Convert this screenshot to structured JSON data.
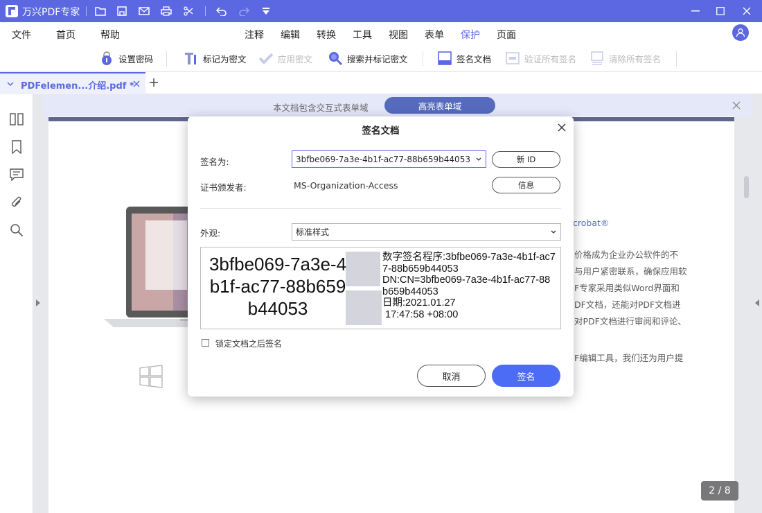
{
  "app": {
    "title": "万兴PDF专家",
    "brand_color": "#5b68e2"
  },
  "menu": {
    "items": [
      "文件",
      "首页",
      "帮助",
      "注释",
      "编辑",
      "转换",
      "工具",
      "视图",
      "表单",
      "保护",
      "页面"
    ],
    "active": "保护"
  },
  "toolbar": {
    "set_password": "设置密码",
    "mark_redaction": "标记为密文",
    "apply_redaction": "应用密文",
    "search_redact": "搜索并标记密文",
    "sign_document": "签名文档",
    "verify_all": "验证所有签名",
    "clear_all": "清除所有签名"
  },
  "tab": {
    "name": "PDFelemen...介绍.pdf *"
  },
  "banner": {
    "text": "本文档包含交互式表单域",
    "button": "高亮表单域"
  },
  "page_text": {
    "acrobat": "crobat®",
    "line1": "价格成为企业办公软件的不",
    "line2": "与用户紧密联系，确保应用软",
    "line3": "F专家采用类似Word界面和",
    "line4": "DF文档，还能对PDF文档进",
    "line5": "对PDF文档进行审阅和评论、",
    "line6": "F编辑工具，我们还为用户提"
  },
  "page_indicator": "2 / 8",
  "dialog": {
    "title": "签名文档",
    "sign_as_label": "签名为:",
    "sign_as_value": "3bfbe069-7a3e-4b1f-ac77-88b659b44053",
    "new_id": "新 ID",
    "issuer_label": "证书颁发者:",
    "issuer_value": "MS-Organization-Access",
    "info": "信息",
    "appearance_label": "外观:",
    "appearance_value": "标准样式",
    "preview": {
      "name": "3bfbe069-7a3e-4b1f-ac77-88b659b44053",
      "detail_signer": "数字签名程序:3bfbe069-7a3e-4b1f-ac77-88b659b44053",
      "detail_dn": "DN:CN=3bfbe069-7a3e-4b1f-ac77-88b659b44053",
      "detail_date": "日期:2021.01.27",
      "detail_time": " 17:47:58 +08:00"
    },
    "lock_label": "锁定文档之后签名",
    "cancel": "取消",
    "sign": "签名"
  }
}
